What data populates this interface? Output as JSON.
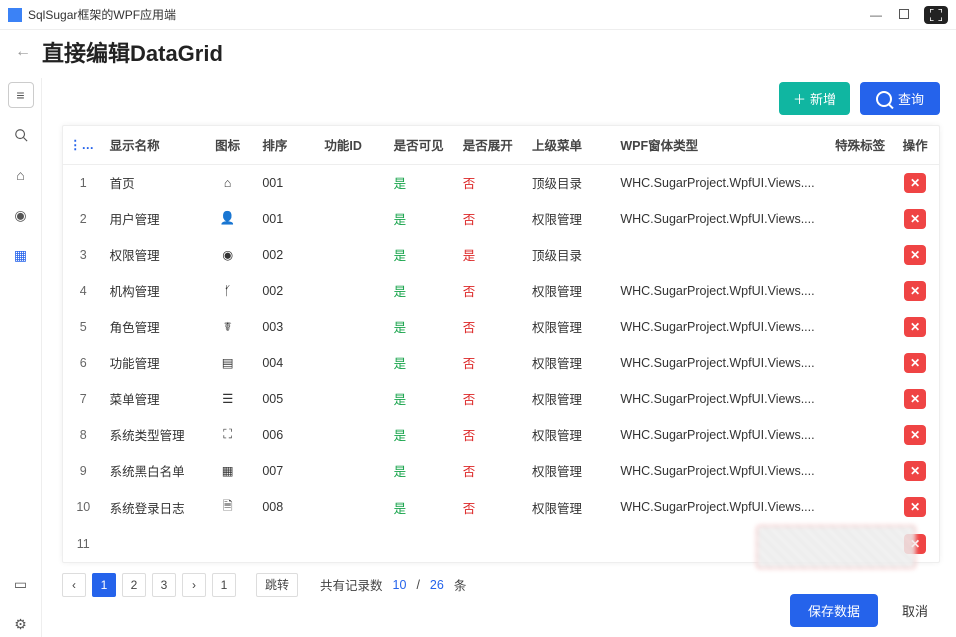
{
  "app": {
    "title": "SqlSugar框架的WPF应用端"
  },
  "page": {
    "title": "直接编辑DataGrid"
  },
  "toolbar": {
    "new_label": "新增",
    "query_label": "查询"
  },
  "columns": {
    "name": "显示名称",
    "icon": "图标",
    "sort": "排序",
    "funcid": "功能ID",
    "visible": "是否可见",
    "expand": "是否展开",
    "parent": "上级菜单",
    "wpf": "WPF窗体类型",
    "tag": "特殊标签",
    "op": "操作"
  },
  "rows": [
    {
      "idx": "1",
      "name": "首页",
      "icon": "⌂",
      "sort": "001",
      "funcid": "",
      "visible": "是",
      "expand": "否",
      "parent": "顶级目录",
      "wpf": "WHC.SugarProject.WpfUI.Views....",
      "tag": ""
    },
    {
      "idx": "2",
      "name": "用户管理",
      "icon": "👤",
      "sort": "001",
      "funcid": "",
      "visible": "是",
      "expand": "否",
      "parent": "权限管理",
      "wpf": "WHC.SugarProject.WpfUI.Views....",
      "tag": ""
    },
    {
      "idx": "3",
      "name": "权限管理",
      "icon": "◉",
      "sort": "002",
      "funcid": "",
      "visible": "是",
      "expand": "是",
      "parent": "顶级目录",
      "wpf": "",
      "tag": ""
    },
    {
      "idx": "4",
      "name": "机构管理",
      "icon": "ᚶ",
      "sort": "002",
      "funcid": "",
      "visible": "是",
      "expand": "否",
      "parent": "权限管理",
      "wpf": "WHC.SugarProject.WpfUI.Views....",
      "tag": ""
    },
    {
      "idx": "5",
      "name": "角色管理",
      "icon": "☤",
      "sort": "003",
      "funcid": "",
      "visible": "是",
      "expand": "否",
      "parent": "权限管理",
      "wpf": "WHC.SugarProject.WpfUI.Views....",
      "tag": ""
    },
    {
      "idx": "6",
      "name": "功能管理",
      "icon": "▤",
      "sort": "004",
      "funcid": "",
      "visible": "是",
      "expand": "否",
      "parent": "权限管理",
      "wpf": "WHC.SugarProject.WpfUI.Views....",
      "tag": ""
    },
    {
      "idx": "7",
      "name": "菜单管理",
      "icon": "☰",
      "sort": "005",
      "funcid": "",
      "visible": "是",
      "expand": "否",
      "parent": "权限管理",
      "wpf": "WHC.SugarProject.WpfUI.Views....",
      "tag": ""
    },
    {
      "idx": "8",
      "name": "系统类型管理",
      "icon": "⛶",
      "sort": "006",
      "funcid": "",
      "visible": "是",
      "expand": "否",
      "parent": "权限管理",
      "wpf": "WHC.SugarProject.WpfUI.Views....",
      "tag": ""
    },
    {
      "idx": "9",
      "name": "系统黑白名单",
      "icon": "▦",
      "sort": "007",
      "funcid": "",
      "visible": "是",
      "expand": "否",
      "parent": "权限管理",
      "wpf": "WHC.SugarProject.WpfUI.Views....",
      "tag": ""
    },
    {
      "idx": "10",
      "name": "系统登录日志",
      "icon": "🗎",
      "sort": "008",
      "funcid": "",
      "visible": "是",
      "expand": "否",
      "parent": "权限管理",
      "wpf": "WHC.SugarProject.WpfUI.Views....",
      "tag": ""
    },
    {
      "idx": "11",
      "name": "",
      "icon": "",
      "sort": "",
      "funcid": "",
      "visible": "",
      "expand": "",
      "parent": "",
      "wpf": "",
      "tag": ""
    }
  ],
  "pager": {
    "pages": [
      "1",
      "2",
      "3"
    ],
    "active": "1",
    "goto_value": "1",
    "jump_label": "跳转",
    "total_label": "共有记录数",
    "current": "10",
    "total": "26",
    "unit": "条"
  },
  "footer": {
    "save_label": "保存数据",
    "cancel_label": "取消"
  }
}
